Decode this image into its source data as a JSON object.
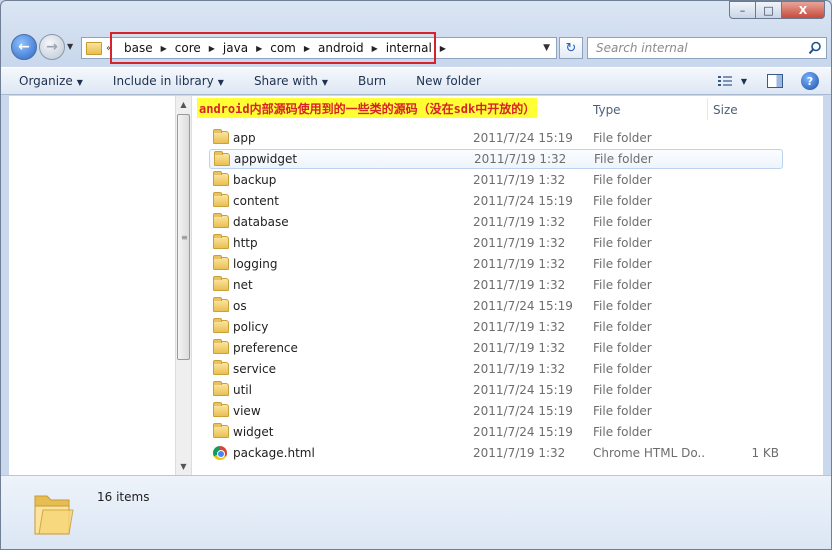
{
  "window": {
    "caption": {
      "minimize": "–",
      "maximize": "□",
      "close": "X"
    }
  },
  "address_bar": {
    "overflow_marker": "«",
    "crumbs": [
      "base",
      "core",
      "java",
      "com",
      "android",
      "internal"
    ],
    "search_placeholder": "Search internal"
  },
  "toolbar": {
    "organize": "Organize",
    "include_in_library": "Include in library",
    "share_with": "Share with",
    "burn": "Burn",
    "new_folder": "New folder"
  },
  "columns": {
    "type": "Type",
    "size": "Size"
  },
  "annotation": "android内部源码使用到的一些类的源码（没在sdk中开放的）",
  "files": [
    {
      "name": "app",
      "date": "2011/7/24 15:19",
      "type": "File folder",
      "size": "",
      "icon": "folder-icon"
    },
    {
      "name": "appwidget",
      "date": "2011/7/19 1:32",
      "type": "File folder",
      "size": "",
      "icon": "folder-icon",
      "selected": true
    },
    {
      "name": "backup",
      "date": "2011/7/19 1:32",
      "type": "File folder",
      "size": "",
      "icon": "folder-icon"
    },
    {
      "name": "content",
      "date": "2011/7/24 15:19",
      "type": "File folder",
      "size": "",
      "icon": "folder-icon"
    },
    {
      "name": "database",
      "date": "2011/7/19 1:32",
      "type": "File folder",
      "size": "",
      "icon": "folder-icon"
    },
    {
      "name": "http",
      "date": "2011/7/19 1:32",
      "type": "File folder",
      "size": "",
      "icon": "folder-icon"
    },
    {
      "name": "logging",
      "date": "2011/7/19 1:32",
      "type": "File folder",
      "size": "",
      "icon": "folder-icon"
    },
    {
      "name": "net",
      "date": "2011/7/19 1:32",
      "type": "File folder",
      "size": "",
      "icon": "folder-icon"
    },
    {
      "name": "os",
      "date": "2011/7/24 15:19",
      "type": "File folder",
      "size": "",
      "icon": "folder-icon"
    },
    {
      "name": "policy",
      "date": "2011/7/19 1:32",
      "type": "File folder",
      "size": "",
      "icon": "folder-icon"
    },
    {
      "name": "preference",
      "date": "2011/7/19 1:32",
      "type": "File folder",
      "size": "",
      "icon": "folder-icon"
    },
    {
      "name": "service",
      "date": "2011/7/19 1:32",
      "type": "File folder",
      "size": "",
      "icon": "folder-icon"
    },
    {
      "name": "util",
      "date": "2011/7/24 15:19",
      "type": "File folder",
      "size": "",
      "icon": "folder-icon"
    },
    {
      "name": "view",
      "date": "2011/7/24 15:19",
      "type": "File folder",
      "size": "",
      "icon": "folder-icon"
    },
    {
      "name": "widget",
      "date": "2011/7/24 15:19",
      "type": "File folder",
      "size": "",
      "icon": "folder-icon"
    },
    {
      "name": "package.html",
      "date": "2011/7/19 1:32",
      "type": "Chrome HTML Do...",
      "size": "1 KB",
      "icon": "chrome-icon"
    }
  ],
  "status": {
    "item_count": "16 items"
  },
  "colors": {
    "annotation_bg": "#ffff33",
    "annotation_text": "#d8222a",
    "highlight_box": "#d8222a"
  }
}
